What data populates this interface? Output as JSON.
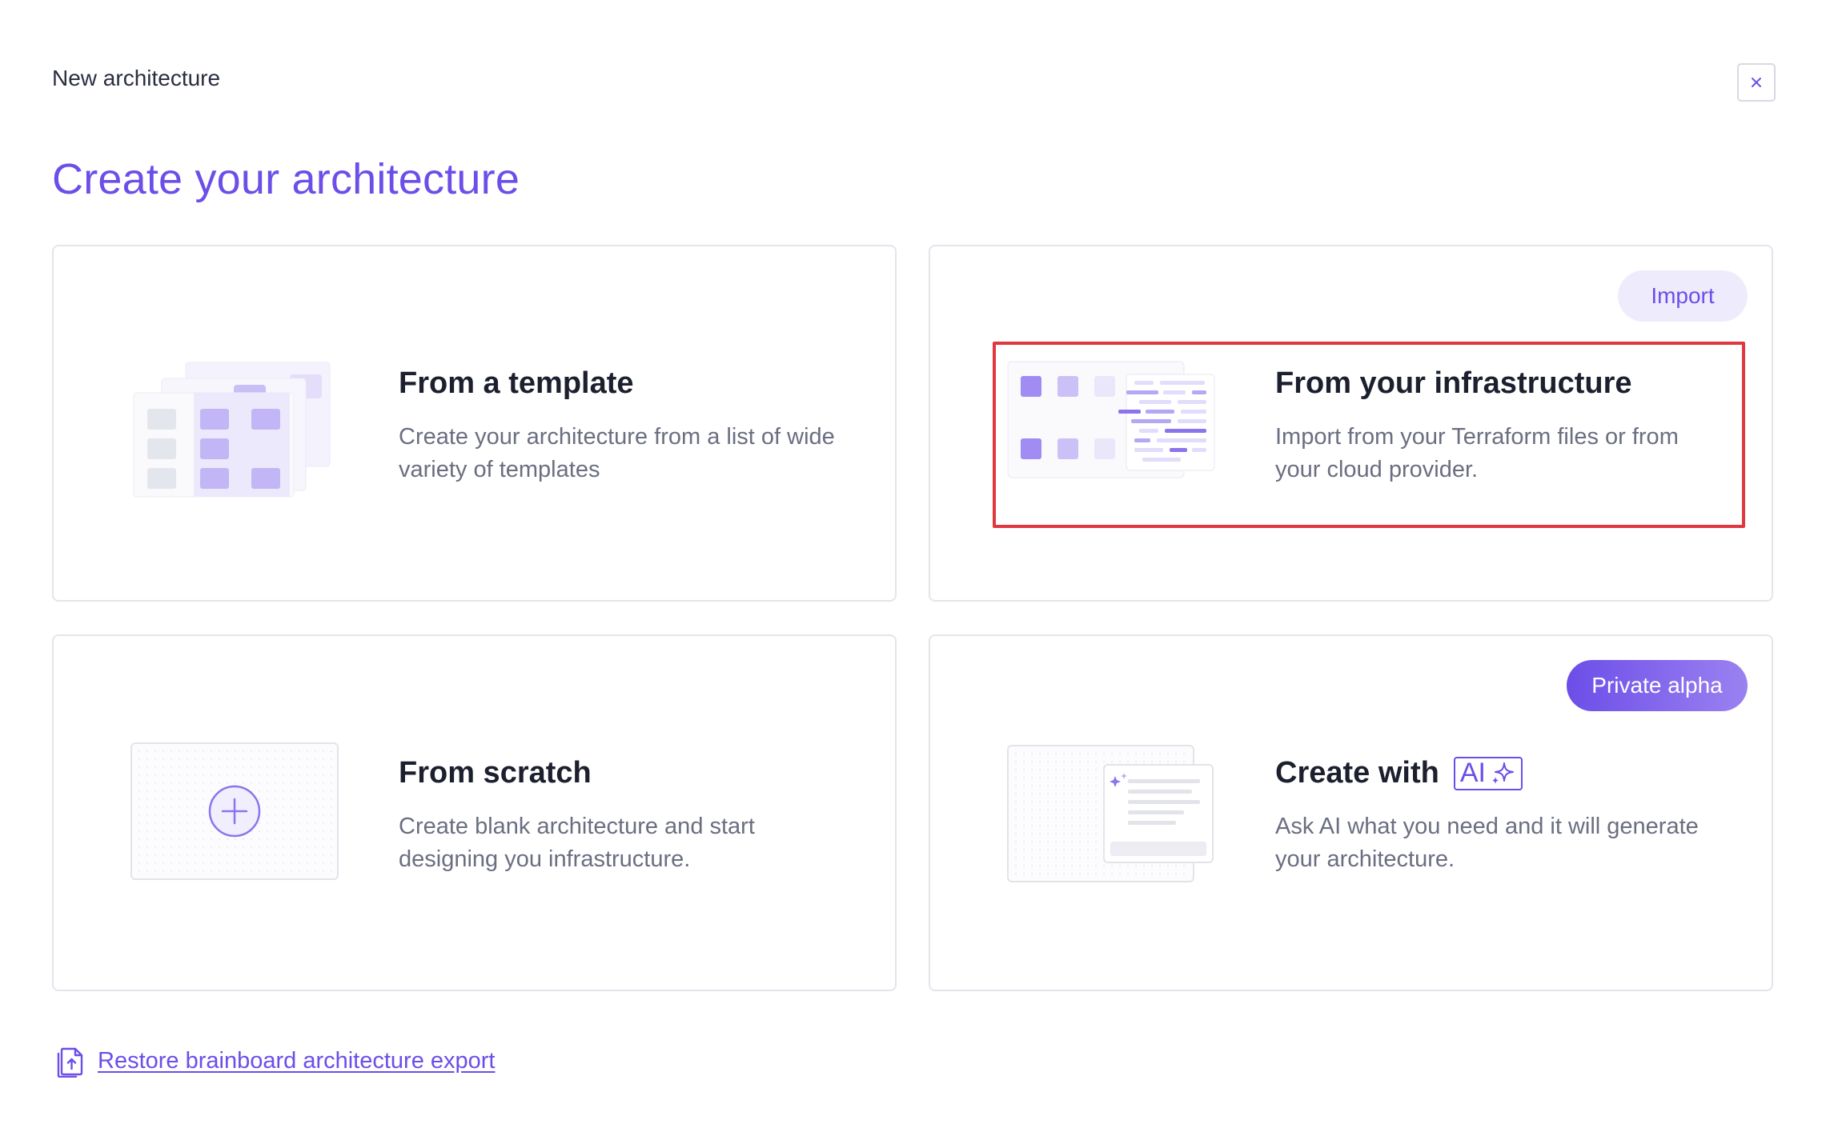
{
  "header": {
    "window_title": "New architecture",
    "close_label": "×"
  },
  "page_title": "Create your architecture",
  "options": [
    {
      "title": "From a template",
      "description": "Create your architecture from a list of wide variety of templates",
      "icon": "template-grid-illustration"
    },
    {
      "title": "From your infrastructure",
      "description": "Import from your Terraform files or from your cloud provider.",
      "badge": "Import",
      "icon": "infrastructure-code-illustration"
    },
    {
      "title": "From scratch",
      "description": "Create blank architecture and start designing you infrastructure.",
      "icon": "plus-circle-illustration"
    },
    {
      "title": "Create with",
      "ai_label": "AI",
      "description": "Ask AI what you need and it will generate your architecture.",
      "badge": "Private alpha",
      "icon": "ai-document-illustration"
    }
  ],
  "footer": {
    "restore_link": "Restore brainboard architecture export",
    "icon": "file-upload-icon"
  },
  "colors": {
    "accent": "#6c4ee8",
    "accent_light": "#eeebfc",
    "highlight": "#e0383e",
    "border": "#e4e5ec"
  }
}
